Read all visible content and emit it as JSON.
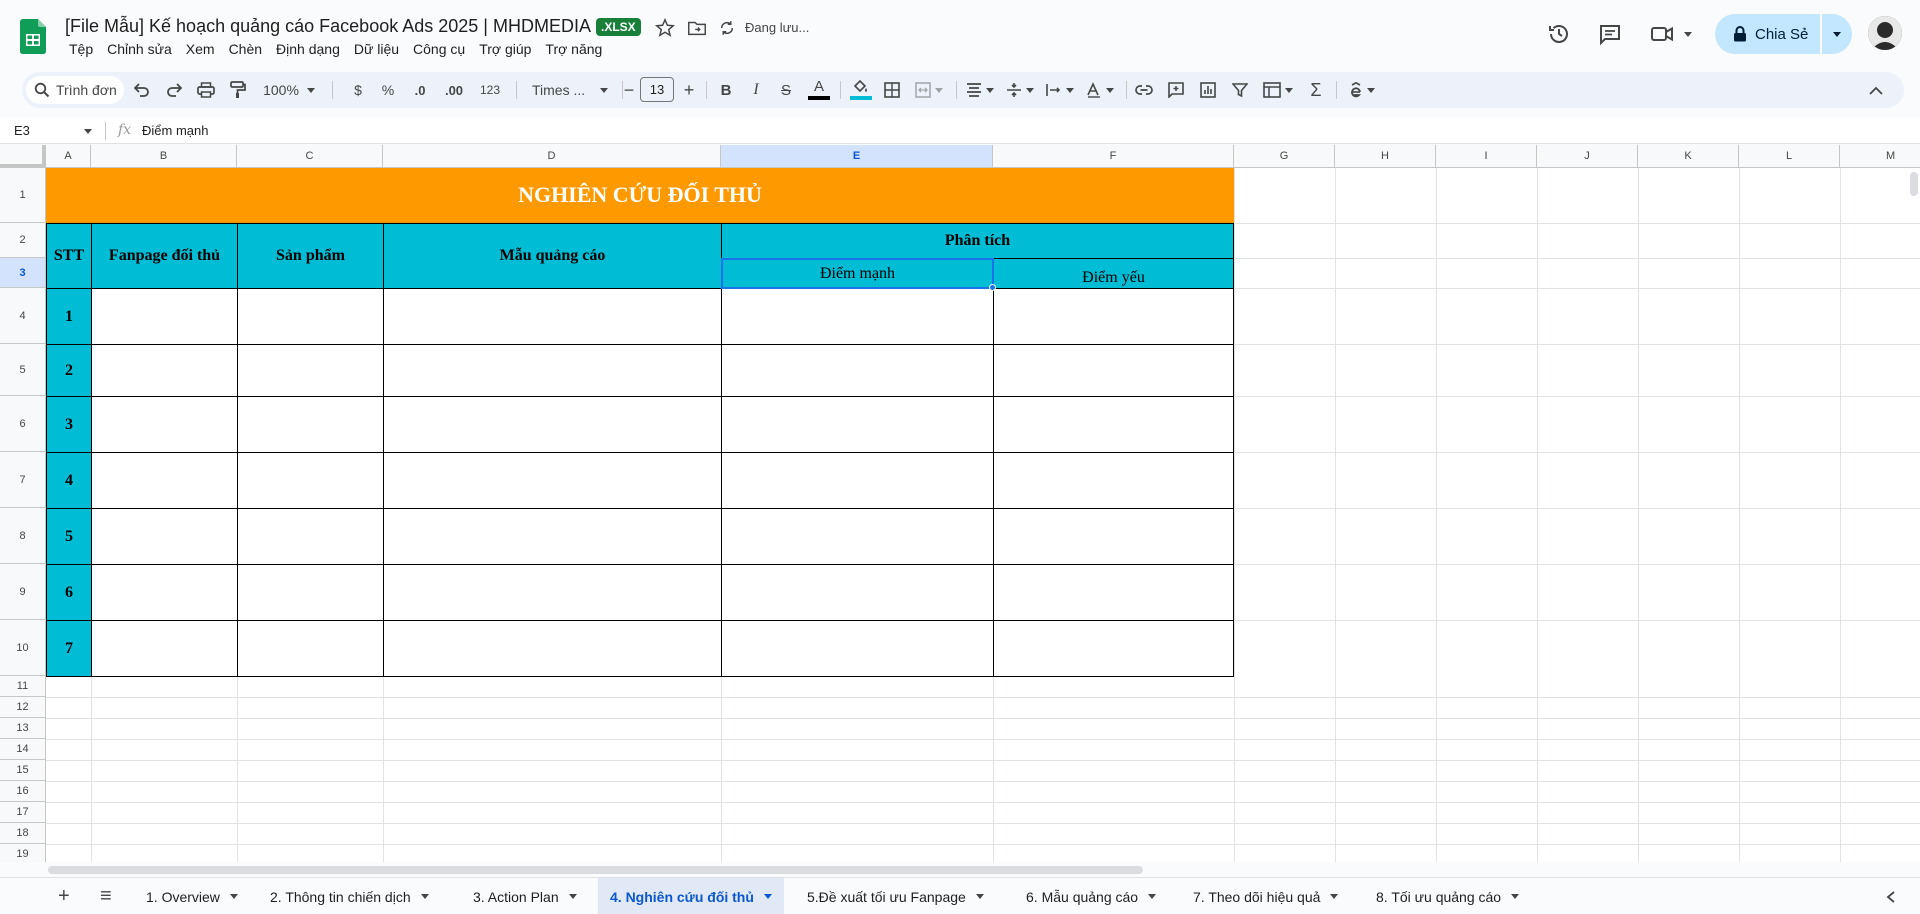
{
  "header": {
    "doc_title": "[File Mẫu] Kế hoạch quảng cáo Facebook Ads 2025 | MHDMEDIA",
    "file_badge": ".XLSX",
    "save_status": "Đang lưu...",
    "share_label": "Chia Sẻ"
  },
  "menu": [
    "Tệp",
    "Chỉnh sửa",
    "Xem",
    "Chèn",
    "Định dạng",
    "Dữ liệu",
    "Công cụ",
    "Trợ giúp",
    "Trợ năng"
  ],
  "toolbar": {
    "search_label": "Trình đơn",
    "zoom": "100%",
    "currency": "$",
    "percent": "%",
    "decrease_decimal": ".0",
    "increase_decimal": ".00",
    "number_format": "123",
    "font_name": "Times ...",
    "font_size": "13",
    "minus": "−",
    "plus": "+",
    "bold": "B",
    "italic": "I",
    "strike": "S",
    "text_color": "A",
    "sum": "Σ"
  },
  "formula_bar": {
    "name_box": "E3",
    "fx": "fx",
    "value": "Điểm mạnh"
  },
  "columns": [
    "A",
    "B",
    "C",
    "D",
    "E",
    "F",
    "G",
    "H",
    "I",
    "J",
    "K",
    "L",
    "M"
  ],
  "rows": [
    "1",
    "2",
    "3",
    "4",
    "5",
    "6",
    "7",
    "8",
    "9",
    "10",
    "11",
    "12",
    "13",
    "14",
    "15",
    "16",
    "17",
    "18",
    "19"
  ],
  "sheet": {
    "title": "NGHIÊN CỨU ĐỐI THỦ",
    "h_stt": "STT",
    "h_fanpage": "Fanpage đối thủ",
    "h_product": "Sản phẩm",
    "h_ad_sample": "Mẫu quảng cáo",
    "h_analysis": "Phân tích",
    "h_strength": "Điểm mạnh",
    "h_weakness": "Điểm yếu",
    "stt": [
      "1",
      "2",
      "3",
      "4",
      "5",
      "6",
      "7"
    ]
  },
  "tabs": {
    "add": "+",
    "list": "≡",
    "items": [
      {
        "label": "1. Overview",
        "active": false
      },
      {
        "label": "2. Thông tin chiến dịch",
        "active": false
      },
      {
        "label": "3. Action Plan",
        "active": false
      },
      {
        "label": "4. Nghiên cứu đối thủ",
        "active": true
      },
      {
        "label": "5.Đề xuất tối ưu Fanpage",
        "active": false
      },
      {
        "label": "6. Mẫu quảng cáo",
        "active": false
      },
      {
        "label": "7. Theo dõi hiệu quả",
        "active": false
      },
      {
        "label": "8. Tối ưu quảng cáo",
        "active": false
      }
    ]
  },
  "colors": {
    "accent": "#0b57d0",
    "title_fill": "#ff9900",
    "header_fill": "#00bcd4",
    "badge": "#188038"
  }
}
